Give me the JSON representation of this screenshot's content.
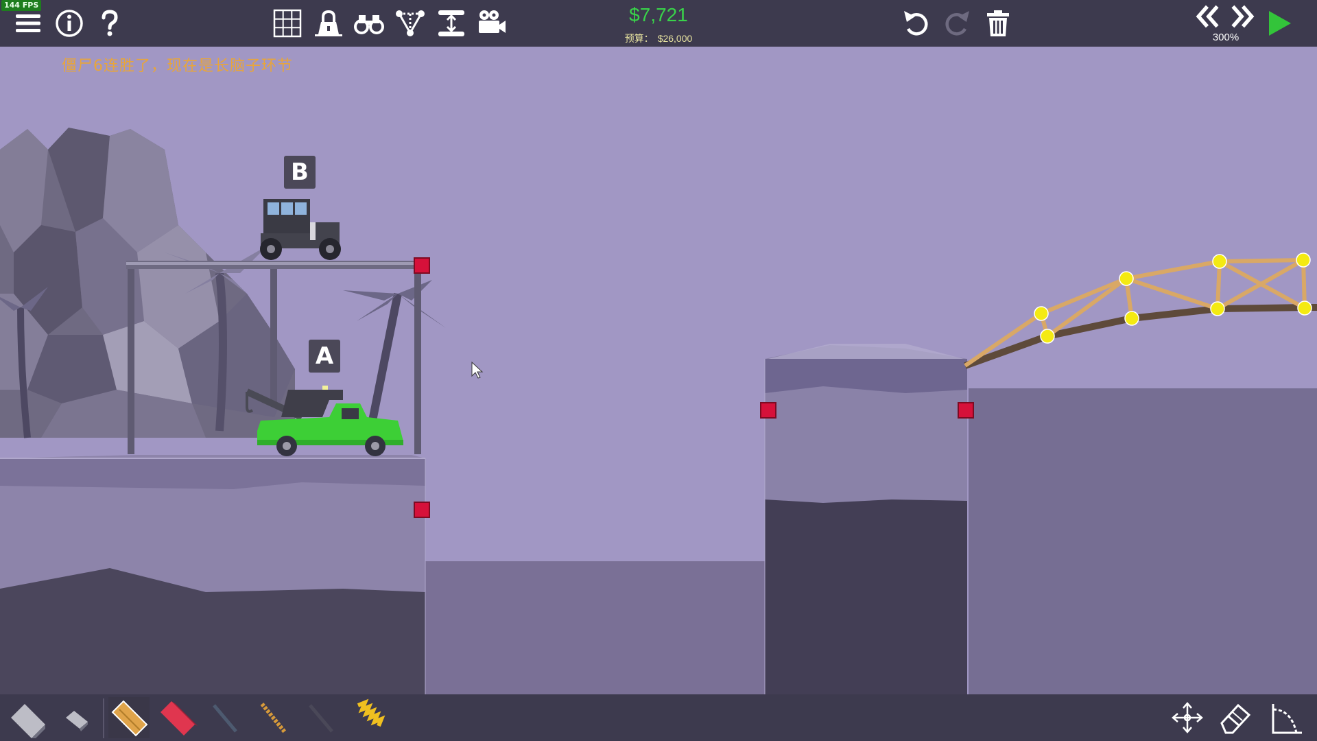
{
  "hud": {
    "fps": "144 FPS",
    "cost": "$7,721",
    "budget_label": "预算：",
    "budget_value": "$26,000",
    "zoom": "300%"
  },
  "notice": "僵尸6连胜了，现在是长脑子环节",
  "scene": {
    "label_b": "B",
    "label_a": "A"
  },
  "toolbar": {
    "left": [
      "menu-icon",
      "info-icon",
      "help-icon"
    ],
    "center": [
      "grid-icon",
      "lock-icon",
      "binoculars-icon",
      "joints-icon",
      "resize-icon",
      "camera-icon"
    ],
    "right": [
      "undo-icon",
      "redo-icon",
      "trash-icon"
    ],
    "playback": [
      "rewind-icon",
      "fast-forward-icon",
      "play-icon"
    ]
  },
  "materials": [
    "road",
    "reinforced-road",
    "wood",
    "steel",
    "cable",
    "rope",
    "hydraulics",
    "spring"
  ],
  "colors": {
    "toolbar_bg": "#3d3a4e",
    "sky": "#a197c4",
    "cost_green": "#39d34a",
    "anchor_red": "#d6113a",
    "joint_yellow": "#f4ea12",
    "wood": "#d9a866",
    "notice_orange": "#e8a53b",
    "truck_green": "#3dcf36"
  }
}
